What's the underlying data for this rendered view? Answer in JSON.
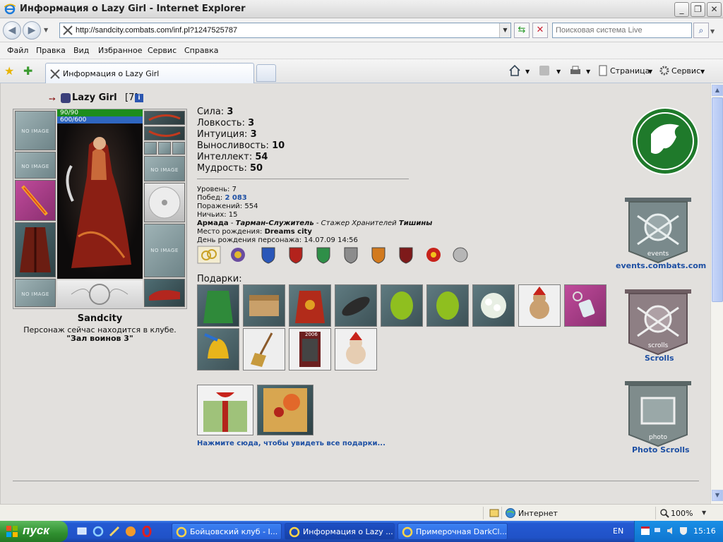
{
  "window": {
    "title": "Информация о Lazy Girl - Internet Explorer",
    "buttons": {
      "minimize": "_",
      "maximize": "❐",
      "close": "✕"
    }
  },
  "address": {
    "url": "http://sandcity.combats.com/inf.pl?1247525787",
    "search_placeholder": "Поисковая система Live"
  },
  "menu": {
    "items": [
      "Файл",
      "Правка",
      "Вид",
      "Избранное",
      "Сервис",
      "Справка"
    ]
  },
  "tabs": {
    "active_label": "Информация о Lazy Girl",
    "commands": {
      "page": "Страница",
      "tools": "Сервис"
    }
  },
  "character": {
    "name": "Lazy Girl",
    "level": "[7]",
    "hp": "90/90",
    "mana": "600/600",
    "no_image": "NO IMAGE",
    "city": "Sandcity",
    "location_text": "Персонаж сейчас находится в клубе.",
    "room": "\"Зал воинов 3\""
  },
  "stats": [
    {
      "label": "Сила:",
      "value": "3"
    },
    {
      "label": "Ловкость:",
      "value": "3"
    },
    {
      "label": "Интуиция:",
      "value": "3"
    },
    {
      "label": "Выносливость:",
      "value": "10"
    },
    {
      "label": "Интеллект:",
      "value": "54"
    },
    {
      "label": "Мудрость:",
      "value": "50"
    }
  ],
  "info": {
    "level_label": "Уровень:",
    "level_value": "7",
    "wins_label": "Побед:",
    "wins_value": "2 083",
    "losses_label": "Поражений:",
    "losses_value": "554",
    "draws_label": "Ничьих:",
    "draws_value": "15",
    "clan": "Армада",
    "clan_rank": "Тарман-Служитель",
    "clan_title_prefix": "Стажер Хранителей",
    "clan_title_name": "Тишины",
    "birthplace_label": "Место рождения:",
    "birthplace_value": "Dreams city",
    "birthday_label": "День рождения персонажа:",
    "birthday_value": "14.07.09 14:56"
  },
  "gifts": {
    "label": "Подарки:",
    "link": "Нажмите сюда, чтобы увидеть все подарки...",
    "book_year": "2006"
  },
  "side": {
    "events_label": "events.combats.com",
    "scrolls_label": "Scrolls",
    "photo_label": "Photo Scrolls",
    "banner_words": [
      "events",
      "scrolls",
      "photo"
    ]
  },
  "status": {
    "zone": "Интернет",
    "zoom": "100%"
  },
  "taskbar": {
    "start": "пуск",
    "tasks": [
      "Бойцовский клуб - I...",
      "Информация о Lazy ...",
      "Примерочная DarkCl..."
    ],
    "lang": "EN",
    "time": "15:16"
  },
  "colors": {
    "link": "#1d4fa3",
    "hp": "#1d8d1d",
    "mana": "#2f66c0",
    "logo_green": "#1f7a2b"
  }
}
